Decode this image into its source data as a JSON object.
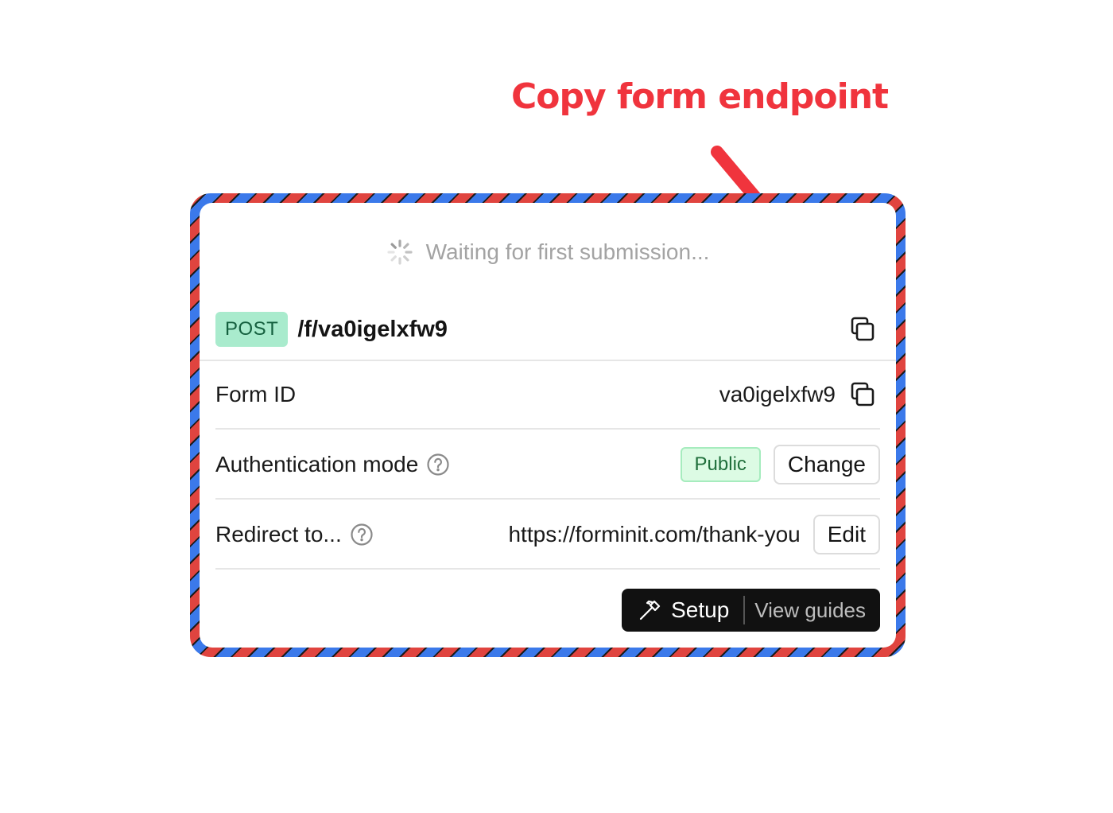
{
  "annotation": {
    "text": "Copy form endpoint",
    "color": "#f0343d"
  },
  "status": {
    "waiting_text": "Waiting for first submission...",
    "spinner_icon": "spinner-icon"
  },
  "endpoint": {
    "method": "POST",
    "path": "/f/va0igelxfw9",
    "copy_icon": "copy-icon"
  },
  "rows": {
    "form_id": {
      "label": "Form ID",
      "value": "va0igelxfw9"
    },
    "auth": {
      "label": "Authentication mode",
      "badge": "Public",
      "button": "Change"
    },
    "redirect": {
      "label": "Redirect to...",
      "value": "https://forminit.com/thank-you",
      "button": "Edit"
    }
  },
  "footer": {
    "setup_label": "Setup",
    "guides_label": "View guides",
    "setup_icon": "hammer-icon"
  },
  "colors": {
    "stripe_red": "#e0443f",
    "stripe_blue": "#3b79ea",
    "method_badge_bg": "#a9ebcd",
    "public_badge_bg": "#dcfbe4"
  }
}
